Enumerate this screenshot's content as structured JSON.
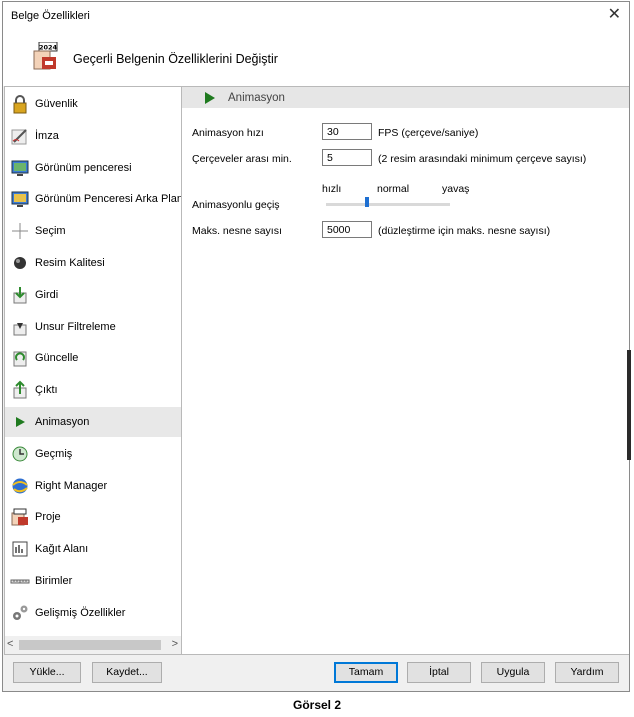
{
  "window": {
    "title": "Belge Özellikleri",
    "close_glyph": "✕"
  },
  "header": {
    "title": "Geçerli Belgenin Özelliklerini Değiştir",
    "icon_text": "2024"
  },
  "nav": {
    "items": [
      {
        "label": "Güvenlik",
        "icon": "padlock-icon"
      },
      {
        "label": "İmza",
        "icon": "signature-pen-icon"
      },
      {
        "label": "Görünüm penceresi",
        "icon": "view-window-icon"
      },
      {
        "label": "Görünüm Penceresi Arka Planı",
        "icon": "view-background-icon"
      },
      {
        "label": "Seçim",
        "icon": "crosshair-icon"
      },
      {
        "label": "Resim Kalitesi",
        "icon": "lens-icon"
      },
      {
        "label": "Girdi",
        "icon": "import-arrow-icon"
      },
      {
        "label": "Unsur Filtreleme",
        "icon": "filter-icon"
      },
      {
        "label": "Güncelle",
        "icon": "refresh-icon"
      },
      {
        "label": "Çıktı",
        "icon": "export-arrow-icon"
      },
      {
        "label": "Animasyon",
        "icon": "play-icon"
      },
      {
        "label": "Geçmiş",
        "icon": "history-clock-icon"
      },
      {
        "label": "Right Manager",
        "icon": "globe-icon"
      },
      {
        "label": "Proje",
        "icon": "project-icon"
      },
      {
        "label": "Kağıt Alanı",
        "icon": "paper-space-icon"
      },
      {
        "label": "Birimler",
        "icon": "ruler-icon"
      },
      {
        "label": "Gelişmiş Özellikler",
        "icon": "gears-icon"
      }
    ],
    "selected_index": 10,
    "scroll_left": "<",
    "scroll_right": ">"
  },
  "section": {
    "title": "Animasyon"
  },
  "form": {
    "fps_label": "Animasyon hızı",
    "fps_value": "30",
    "fps_hint": "FPS (çerçeve/saniye)",
    "frames_label": "Çerçeveler arası min.",
    "frames_value": "5",
    "frames_hint": "(2 resim arasındaki minimum çerçeve sayısı)",
    "transition_label": "Animasyonlu geçiş",
    "slider_fast": "hızlı",
    "slider_normal": "normal",
    "slider_slow": "yavaş",
    "slider_level_percent": 33,
    "max_label": "Maks. nesne sayısı",
    "max_value": "5000",
    "max_hint": "(düzleştirme için maks. nesne sayısı)"
  },
  "buttons": {
    "load": "Yükle...",
    "save": "Kaydet...",
    "ok": "Tamam",
    "cancel": "İptal",
    "apply": "Uygula",
    "help": "Yardım"
  },
  "caption": "Görsel 2"
}
